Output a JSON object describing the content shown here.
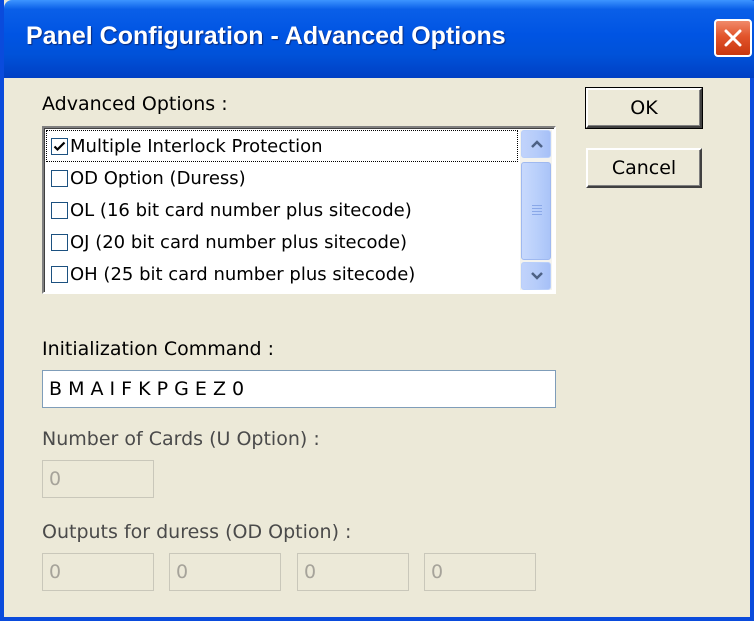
{
  "window": {
    "title": "Panel Configuration - Advanced Options",
    "close_icon": "close-icon"
  },
  "advanced_options": {
    "label": "Advanced Options :",
    "items": [
      {
        "label": "Multiple Interlock Protection",
        "checked": true
      },
      {
        "label": "OD Option (Duress)",
        "checked": false
      },
      {
        "label": "OL (16 bit card number plus sitecode)",
        "checked": false
      },
      {
        "label": "OJ (20 bit card number plus sitecode)",
        "checked": false
      },
      {
        "label": "OH (25 bit card number plus sitecode)",
        "checked": false
      }
    ]
  },
  "buttons": {
    "ok": "OK",
    "cancel": "Cancel"
  },
  "init_command": {
    "label": "Initialization Command :",
    "value": "B M A I F K P G E Z 0"
  },
  "cards": {
    "label": "Number of Cards (U Option)  :",
    "value": "0"
  },
  "duress": {
    "label": "Outputs for duress (OD Option) :",
    "values": [
      "0",
      "0",
      "0",
      "0"
    ]
  },
  "colors": {
    "title_bar": "#0054e3",
    "dialog_bg": "#ece9d8",
    "close_button": "#e2542b"
  }
}
